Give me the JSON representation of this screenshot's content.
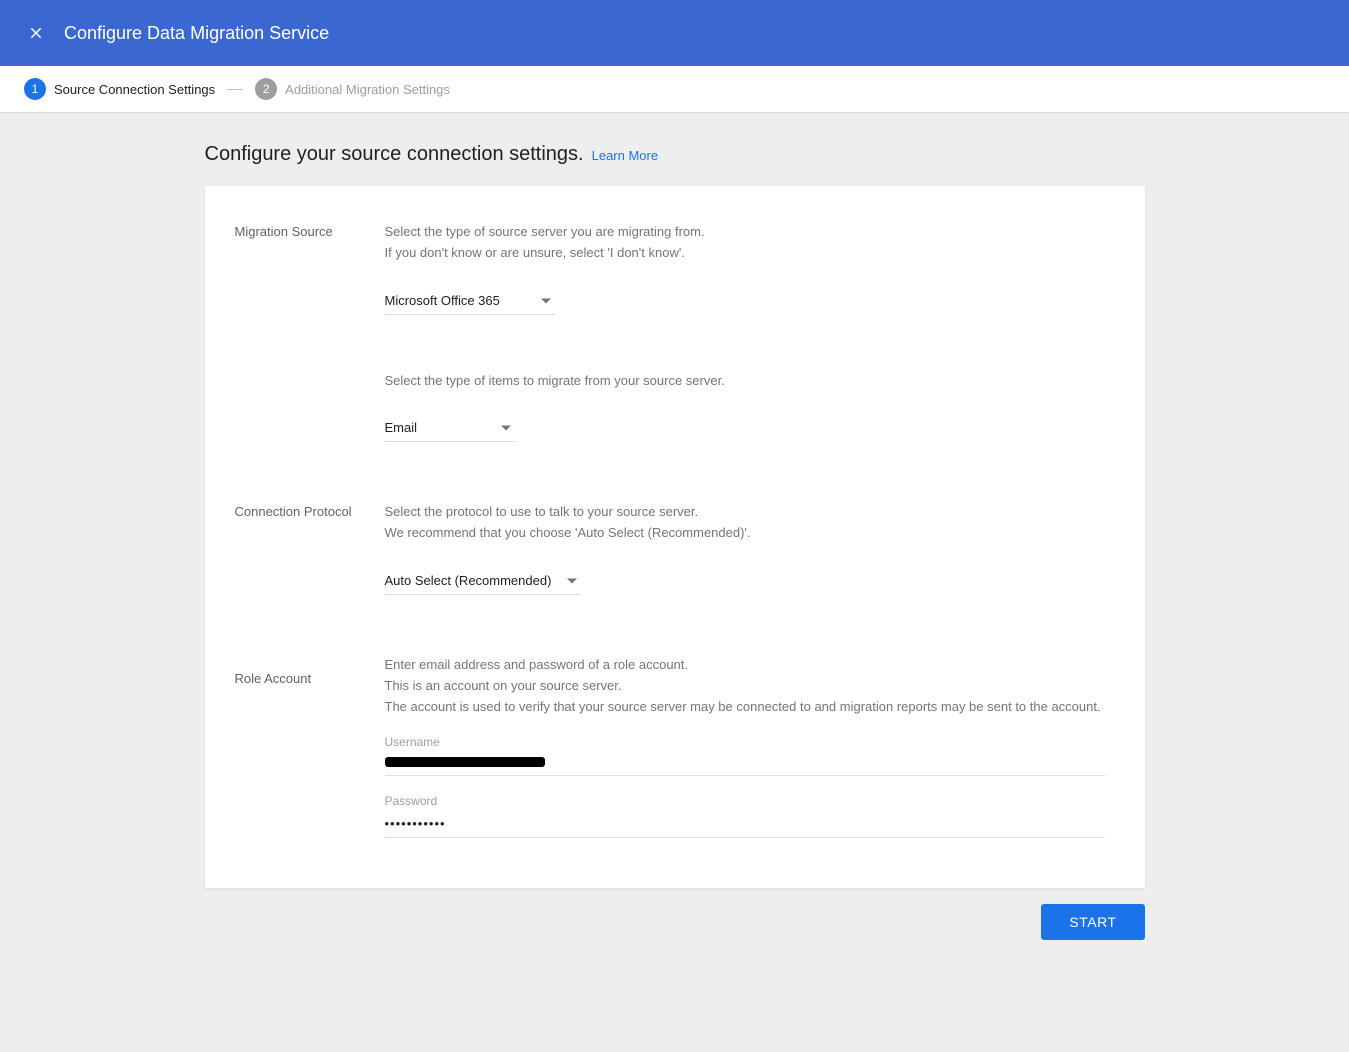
{
  "header": {
    "title": "Configure Data Migration Service"
  },
  "stepper": {
    "step1_label": "Source Connection Settings",
    "step2_label": "Additional Migration Settings"
  },
  "page": {
    "heading": "Configure your source connection settings.",
    "learn_more": "Learn More"
  },
  "migration_source": {
    "label": "Migration Source",
    "help_line1": "Select the type of source server you are migrating from.",
    "help_line2": "If you don't know or are unsure, select 'I don't know'.",
    "selected": "Microsoft Office 365",
    "items_help": "Select the type of items to migrate from your source server.",
    "items_selected": "Email"
  },
  "connection_protocol": {
    "label": "Connection Protocol",
    "help_line1": "Select the protocol to use to talk to your source server.",
    "help_line2": "We recommend that you choose 'Auto Select (Recommended)'.",
    "selected": "Auto Select (Recommended)"
  },
  "role_account": {
    "label": "Role Account",
    "help_line1": "Enter email address and password of a role account.",
    "help_line2": "This is an account on your source server.",
    "help_line3": "The account is used to verify that your source server may be connected to and migration reports may be sent to the account.",
    "username_label": "Username",
    "username_value": "",
    "password_label": "Password",
    "password_value": "•••••••••••"
  },
  "footer": {
    "start_label": "START"
  }
}
